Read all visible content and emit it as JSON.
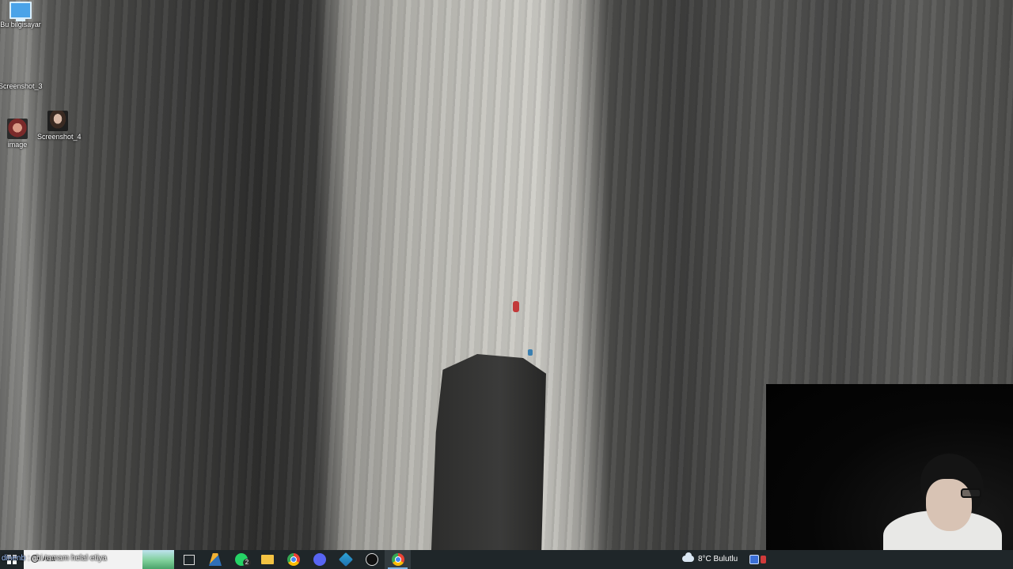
{
  "desktop": {
    "icons": [
      {
        "label": "Bu bilgisayar",
        "icon": "computer-icon"
      },
      {
        "label": "Screenshot_3",
        "icon": "image-file-icon"
      },
      {
        "label": "image",
        "icon": "image-file-icon"
      },
      {
        "label": "Screenshot_4",
        "icon": "image-file-icon"
      }
    ]
  },
  "overlay": {
    "chat_user": "dinenb",
    "chat_message": ": abi tamam helal etiya"
  },
  "taskbar": {
    "search_placeholder": "Ara",
    "apps": [
      {
        "name": "task-view",
        "icon": "task-view-icon"
      },
      {
        "name": "app",
        "icon": "app-icon"
      },
      {
        "name": "whatsapp",
        "icon": "whatsapp-icon",
        "badge": "2"
      },
      {
        "name": "file-explorer",
        "icon": "folder-icon"
      },
      {
        "name": "chrome",
        "icon": "chrome-icon"
      },
      {
        "name": "discord",
        "icon": "discord-icon"
      },
      {
        "name": "app",
        "icon": "app-icon"
      },
      {
        "name": "obs",
        "icon": "obs-icon"
      },
      {
        "name": "chrome",
        "icon": "chrome-icon",
        "active": true
      }
    ],
    "weather": "8°C Bulutlu"
  },
  "colors": {
    "taskbar_bg": "#1f2629",
    "search_bg": "#f2f2f2",
    "active_indicator": "#7fb4e6"
  }
}
